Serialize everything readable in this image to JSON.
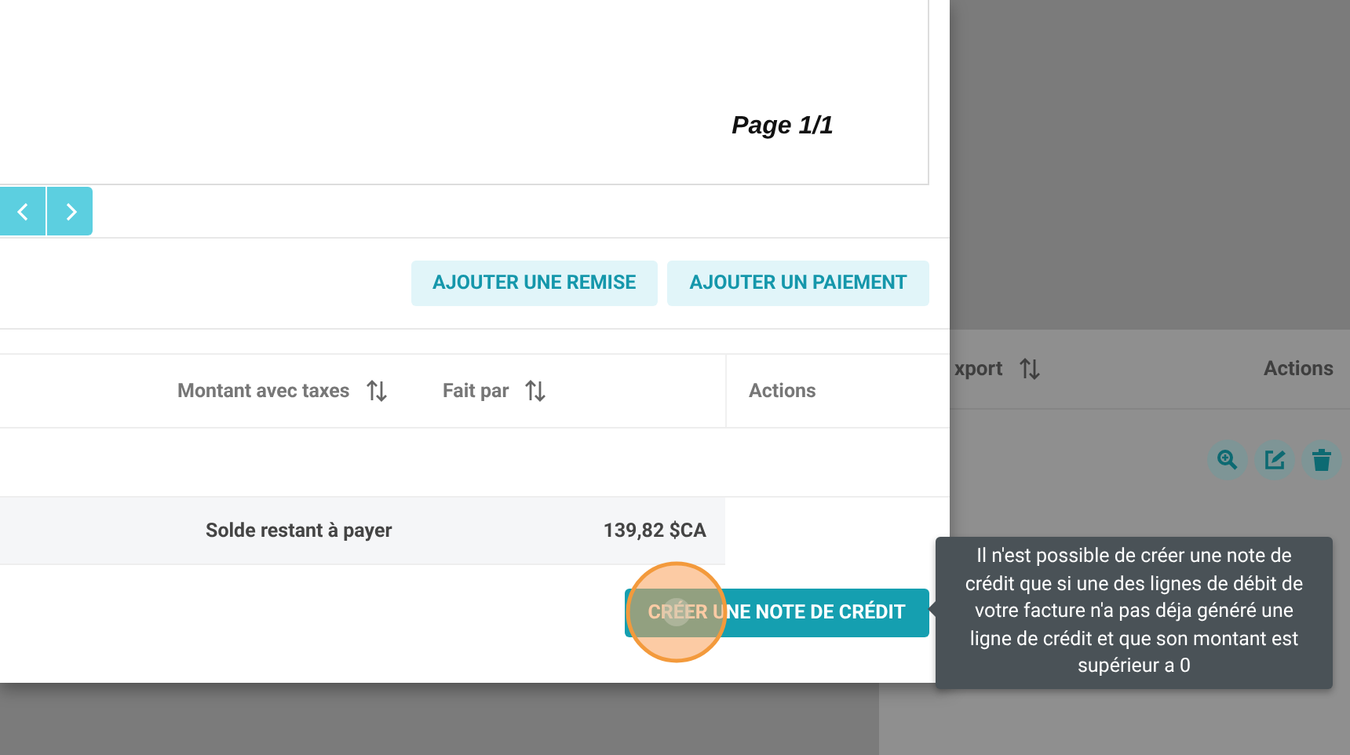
{
  "background_table": {
    "columns": [
      {
        "label": "xport",
        "sortable": true
      },
      {
        "label": "Actions",
        "sortable": false
      }
    ]
  },
  "modal": {
    "preview": {
      "page_label": "Page 1/1"
    },
    "actions": [
      "AJOUTER UNE REMISE",
      "AJOUTER UN PAIEMENT"
    ],
    "table": {
      "columns": [
        {
          "label": "Montant avec taxes",
          "sortable": true
        },
        {
          "label": "Fait par",
          "sortable": true
        },
        {
          "label": "Actions",
          "sortable": false
        }
      ],
      "total": {
        "label": "Solde restant à payer",
        "value": "139,82 $CA"
      }
    },
    "primary_button": "CRÉER UNE NOTE DE CRÉDIT"
  },
  "tooltip": {
    "text": "Il n'est possible de créer une note de crédit que si une des lignes de débit de votre facture n'a pas déja généré une ligne de crédit et que son montant est supérieur a 0"
  }
}
